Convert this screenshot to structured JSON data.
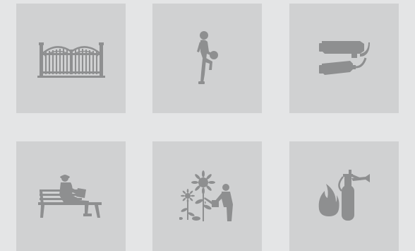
{
  "colors": {
    "page_background": "#e4e5e6",
    "tile_background": "#d0d1d2",
    "icon_color": "#8e8f90"
  },
  "amenities": [
    {
      "icon": "gate-icon"
    },
    {
      "icon": "child-playing-ball-icon"
    },
    {
      "icon": "security-camera-icon"
    },
    {
      "icon": "person-on-bench-icon"
    },
    {
      "icon": "gardening-sunflower-icon"
    },
    {
      "icon": "fire-extinguisher-icon"
    }
  ]
}
